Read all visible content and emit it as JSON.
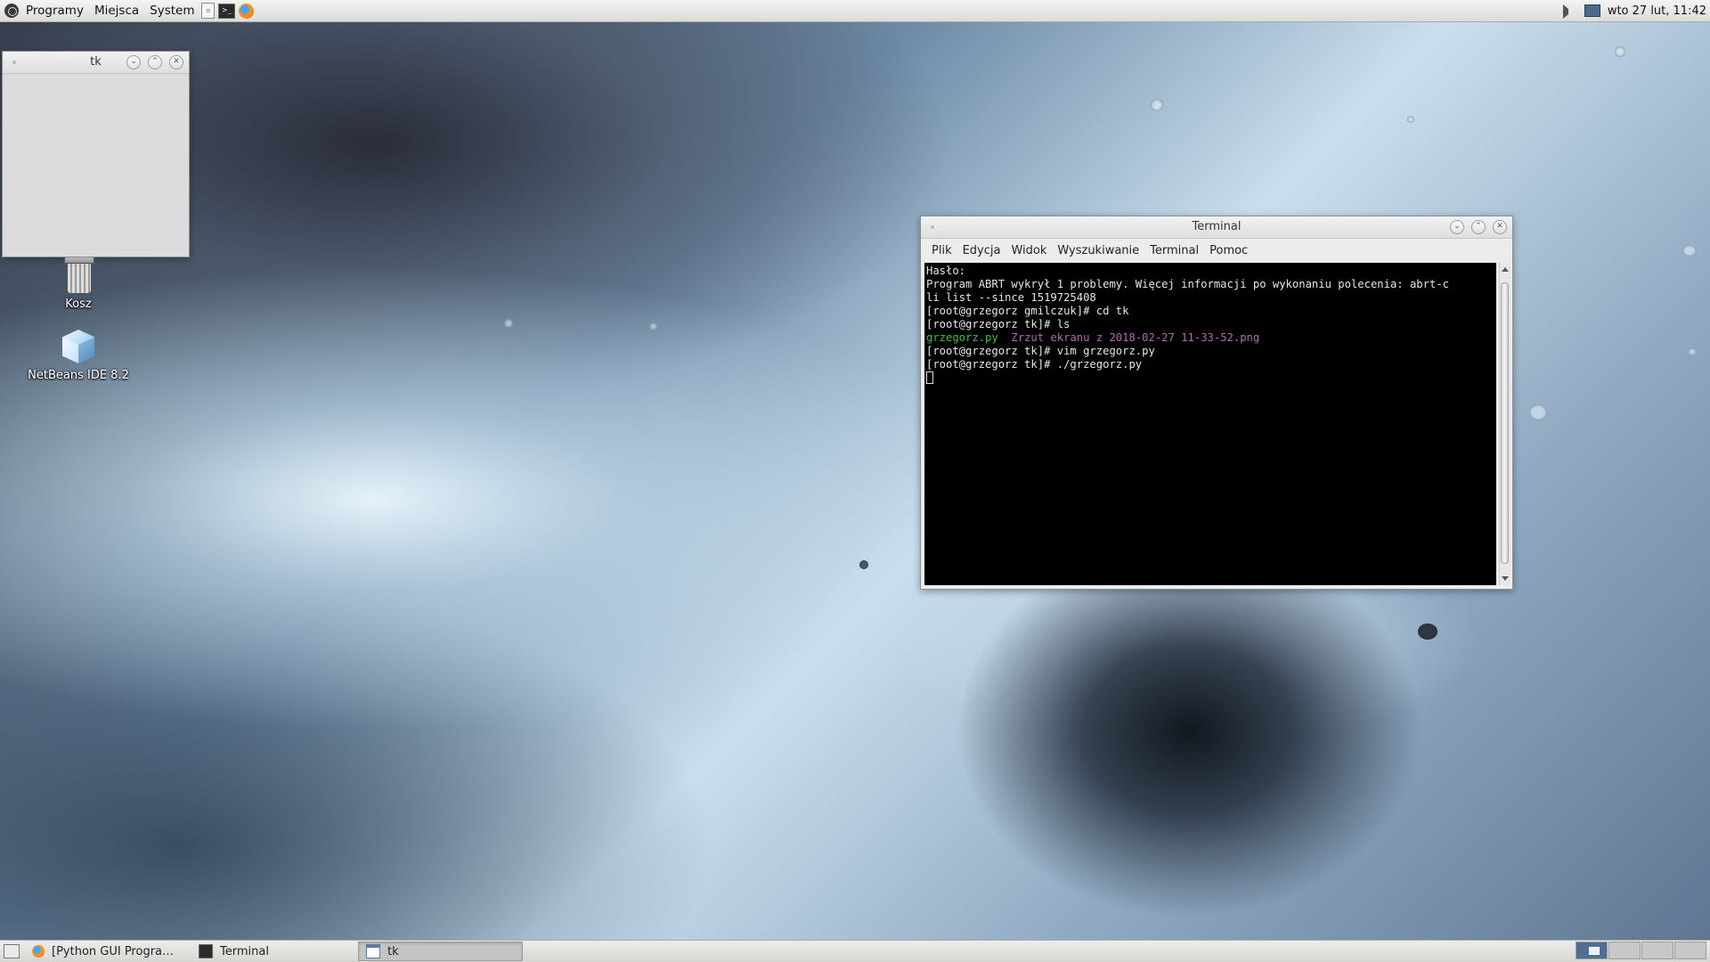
{
  "top_panel": {
    "menus": [
      "Programy",
      "Miejsca",
      "System"
    ],
    "launchers": [
      "text-editor-icon",
      "terminal-icon",
      "firefox-icon"
    ],
    "tray_icons": [
      "volume-icon",
      "network-icon"
    ],
    "clock": "wto 27 lut, 11:42"
  },
  "desktop_icons": [
    {
      "label": "Kosz",
      "icon": "trash-icon"
    },
    {
      "label": "NetBeans IDE 8.2",
      "icon": "netbeans-icon"
    }
  ],
  "tk_window": {
    "title": "tk"
  },
  "terminal_window": {
    "title": "Terminal",
    "menu": [
      "Plik",
      "Edycja",
      "Widok",
      "Wyszukiwanie",
      "Terminal",
      "Pomoc"
    ],
    "lines": [
      "Hasło:",
      "Program ABRT wykrył 1 problemy. Więcej informacji po wykonaniu polecenia: abrt-c",
      "li list --since 1519725408",
      "[root@grzegorz gmilczuk]# cd tk",
      "[root@grzegorz tk]# ls"
    ],
    "ls_output": {
      "file1": "grzegorz.py",
      "file2": "Zrzut ekranu z 2018-02-27 11-33-52.png"
    },
    "lines_after": [
      "[root@grzegorz tk]# vim grzegorz.py",
      "[root@grzegorz tk]# ./grzegorz.py"
    ],
    "colors": {
      "background": "#000000",
      "text": "#e6e6e6",
      "executable": "#3fc23f",
      "image": "#b566b5"
    }
  },
  "bottom_panel": {
    "tasks": [
      {
        "label": "[Python GUI Program...",
        "icon": "firefox-icon",
        "active": false
      },
      {
        "label": "Terminal",
        "icon": "terminal-icon",
        "active": false
      },
      {
        "label": "tk",
        "icon": "window-icon",
        "active": true
      }
    ],
    "workspaces": 4,
    "current_workspace": 1
  }
}
